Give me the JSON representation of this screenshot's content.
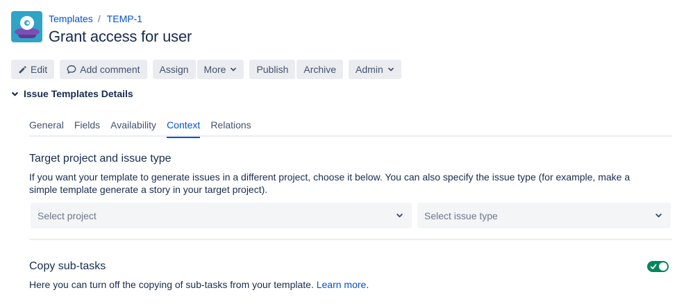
{
  "breadcrumb": {
    "parent": "Templates",
    "separator": "/",
    "current": "TEMP-1"
  },
  "page_title": "Grant access for user",
  "toolbar": {
    "edit": "Edit",
    "add_comment": "Add comment",
    "assign": "Assign",
    "more": "More",
    "publish": "Publish",
    "archive": "Archive",
    "admin": "Admin"
  },
  "section": {
    "title": "Issue Templates Details"
  },
  "tabs": [
    {
      "label": "General",
      "active": false
    },
    {
      "label": "Fields",
      "active": false
    },
    {
      "label": "Availability",
      "active": false
    },
    {
      "label": "Context",
      "active": true
    },
    {
      "label": "Relations",
      "active": false
    }
  ],
  "target": {
    "title": "Target project and issue type",
    "description": "If you want your template to generate issues in a different project, choose it below. You can also specify the issue type (for example, make a simple template generate a story in your target project).",
    "project_placeholder": "Select project",
    "issue_type_placeholder": "Select issue type"
  },
  "subtasks": {
    "title": "Copy sub-tasks",
    "description": "Here you can turn off the copying of sub-tasks from your template.",
    "link": "Learn more",
    "suffix": ".",
    "enabled": true
  },
  "colors": {
    "link": "#0052CC",
    "text": "#172B4D",
    "button_bg": "#EBECF0",
    "toggle_on": "#00875A",
    "avatar_bg": "#2fa4c7"
  },
  "icons": [
    "project-avatar-icon",
    "pencil-icon",
    "comment-icon",
    "chevron-down-icon",
    "check-icon"
  ]
}
